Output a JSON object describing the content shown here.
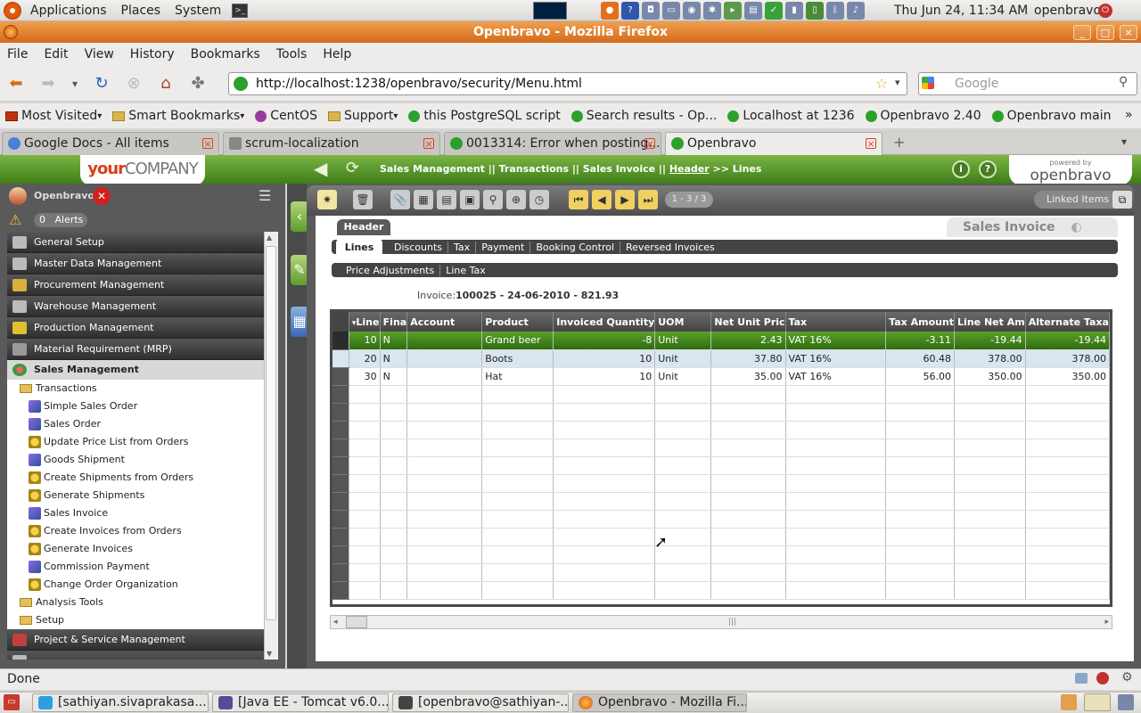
{
  "gnome": {
    "menus": [
      "Applications",
      "Places",
      "System"
    ],
    "clock": "Thu Jun 24, 11:34 AM",
    "user": "openbravo"
  },
  "window": {
    "title": "Openbravo - Mozilla Firefox"
  },
  "menubar": [
    "File",
    "Edit",
    "View",
    "History",
    "Bookmarks",
    "Tools",
    "Help"
  ],
  "nav": {
    "url": "http://localhost:1238/openbravo/security/Menu.html",
    "search_placeholder": "Google"
  },
  "bookmarks": [
    {
      "label": "Most Visited",
      "type": "folder"
    },
    {
      "label": "Smart Bookmarks",
      "type": "folder"
    },
    {
      "label": "CentOS",
      "type": "link"
    },
    {
      "label": "Support",
      "type": "folder"
    },
    {
      "label": "this PostgreSQL script",
      "type": "link"
    },
    {
      "label": "Search results - Op...",
      "type": "link"
    },
    {
      "label": "Localhost at 1236",
      "type": "link"
    },
    {
      "label": "Openbravo 2.40",
      "type": "link"
    },
    {
      "label": "Openbravo main",
      "type": "link"
    }
  ],
  "tabs": [
    {
      "label": "Google Docs - All items"
    },
    {
      "label": "scrum-localization"
    },
    {
      "label": "0013314: Error when posting..."
    },
    {
      "label": "Openbravo",
      "active": true
    }
  ],
  "header": {
    "logo_your": "your",
    "logo_company": "COMPANY",
    "breadcrumb_path": "Sales Management || Transactions || Sales Invoice  ||",
    "breadcrumb_header": "Header",
    "breadcrumb_sep": ">>",
    "breadcrumb_current": "Lines",
    "powered_by": "powered by",
    "brand": "openbravo"
  },
  "left": {
    "user_name": "Openbravo",
    "alert_count": "0",
    "alert_label": "Alerts",
    "menu_top": [
      "General Setup",
      "Master Data Management",
      "Procurement Management",
      "Warehouse Management",
      "Production Management",
      "Material Requirement (MRP)"
    ],
    "open_menu": "Sales Management",
    "transactions_label": "Transactions",
    "transactions": [
      {
        "label": "Simple Sales Order",
        "kind": "f"
      },
      {
        "label": "Sales Order",
        "kind": "f"
      },
      {
        "label": "Update Price List from Orders",
        "kind": "p"
      },
      {
        "label": "Goods Shipment",
        "kind": "f"
      },
      {
        "label": "Create Shipments from Orders",
        "kind": "p"
      },
      {
        "label": "Generate Shipments",
        "kind": "p"
      },
      {
        "label": "Sales Invoice",
        "kind": "f"
      },
      {
        "label": "Create Invoices from Orders",
        "kind": "p"
      },
      {
        "label": "Generate Invoices",
        "kind": "p"
      },
      {
        "label": "Commission Payment",
        "kind": "f"
      },
      {
        "label": "Change Order Organization",
        "kind": "p"
      }
    ],
    "folders_after": [
      "Analysis Tools",
      "Setup"
    ],
    "menu_bottom": [
      "Project & Service Management"
    ]
  },
  "main": {
    "record_position": "1 - 3 / 3",
    "linked_items": "Linked Items",
    "window_tab": "Sales Invoice",
    "header_tab": "Header",
    "lines_tab": "Lines",
    "subtabs": [
      "Discounts",
      "Tax",
      "Payment",
      "Booking Control",
      "Reversed Invoices"
    ],
    "subtabs2": [
      "Price Adjustments",
      "Line Tax"
    ],
    "invoice_label": "Invoice:",
    "invoice_value": "100025 - 24-06-2010 - 821.93",
    "columns": [
      "Line",
      "Fina",
      "Account",
      "Product",
      "Invoiced Quantity",
      "UOM",
      "Net Unit Pric",
      "Tax",
      "Tax Amount",
      "Line Net Am",
      "Alternate Taxa"
    ],
    "rows": [
      [
        "10",
        "N",
        "",
        "Grand beer",
        "-8",
        "Unit",
        "2.43",
        "VAT 16%",
        "-3.11",
        "-19.44",
        "-19.44"
      ],
      [
        "20",
        "N",
        "",
        "Boots",
        "10",
        "Unit",
        "37.80",
        "VAT 16%",
        "60.48",
        "378.00",
        "378.00"
      ],
      [
        "30",
        "N",
        "",
        "Hat",
        "10",
        "Unit",
        "35.00",
        "VAT 16%",
        "56.00",
        "350.00",
        "350.00"
      ]
    ]
  },
  "status": "Done",
  "taskbar": [
    {
      "label": "[sathiyan.sivaprakasa..."
    },
    {
      "label": "[Java EE - Tomcat v6.0..."
    },
    {
      "label": "[openbravo@sathiyan-..."
    },
    {
      "label": "Openbravo - Mozilla Fi...",
      "active": true
    }
  ]
}
